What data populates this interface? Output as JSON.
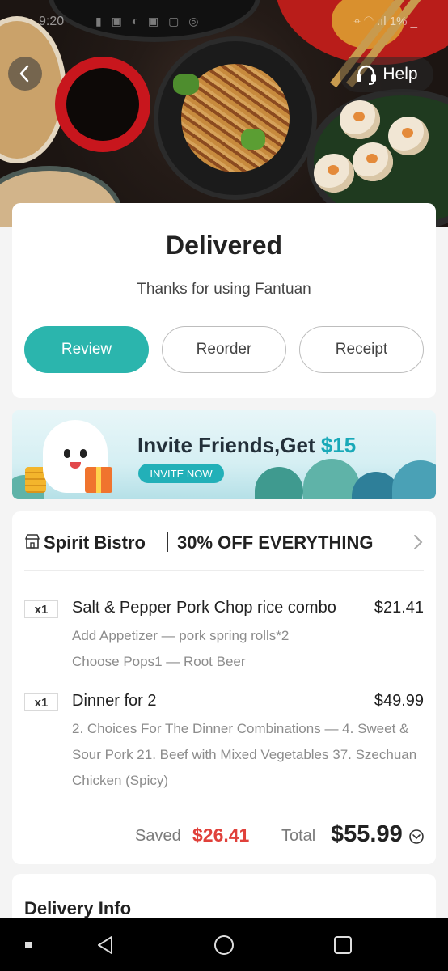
{
  "statusbar": {
    "time": "9:20",
    "icons": "▮ ▣ ◐ ▣ ▢ ◎",
    "right": "⌖ ◠ .ıl 1% _"
  },
  "header": {
    "help_label": "Help"
  },
  "status": {
    "title": "Delivered",
    "subtitle": "Thanks for using Fantuan",
    "buttons": {
      "review": "Review",
      "reorder": "Reorder",
      "receipt": "Receipt"
    }
  },
  "banner": {
    "title": "Invite Friends,Get ",
    "amount": "$15",
    "cta": "INVITE NOW"
  },
  "order": {
    "restaurant": "Spirit Bistro",
    "promo": "30% OFF EVERYTHING",
    "items": [
      {
        "qty": "x1",
        "name": "Salt & Pepper Pork Chop rice combo",
        "price": "$21.41",
        "options": [
          "Add Appetizer — pork spring rolls*2",
          "Choose Pops1 — Root Beer"
        ]
      },
      {
        "qty": "x1",
        "name": "Dinner for 2",
        "price": "$49.99",
        "options": [
          "2. Choices For The Dinner Combinations — 4. Sweet & Sour Pork 21. Beef with Mixed Vegetables 37. Szechuan Chicken (Spicy)"
        ]
      }
    ],
    "saved_label": "Saved",
    "saved_amount": "$26.41",
    "total_label": "Total",
    "total_amount": "$55.99"
  },
  "delivery": {
    "title": "Delivery Info"
  },
  "colors": {
    "accent": "#2bb5ad",
    "saved": "#e0413b"
  }
}
